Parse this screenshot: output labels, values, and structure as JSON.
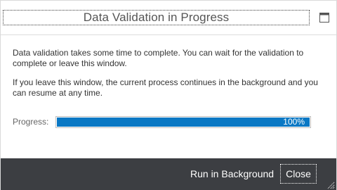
{
  "dialog": {
    "title": "Data Validation in Progress",
    "restore_icon": "window-restore-icon"
  },
  "content": {
    "paragraph_1": "Data validation takes some time to complete. You can wait for the validation to complete or leave this window.",
    "paragraph_2": "If you leave this window, the current process continues in the background and you can resume at any time."
  },
  "progress": {
    "label": "Progress:",
    "value_text": "100%",
    "fraction": 1.0,
    "bar_color": "#0a78c4"
  },
  "footer": {
    "run_background_label": "Run in Background",
    "close_label": "Close",
    "background_color": "#3c3e42",
    "resize_icon": "resize-grip-icon"
  }
}
